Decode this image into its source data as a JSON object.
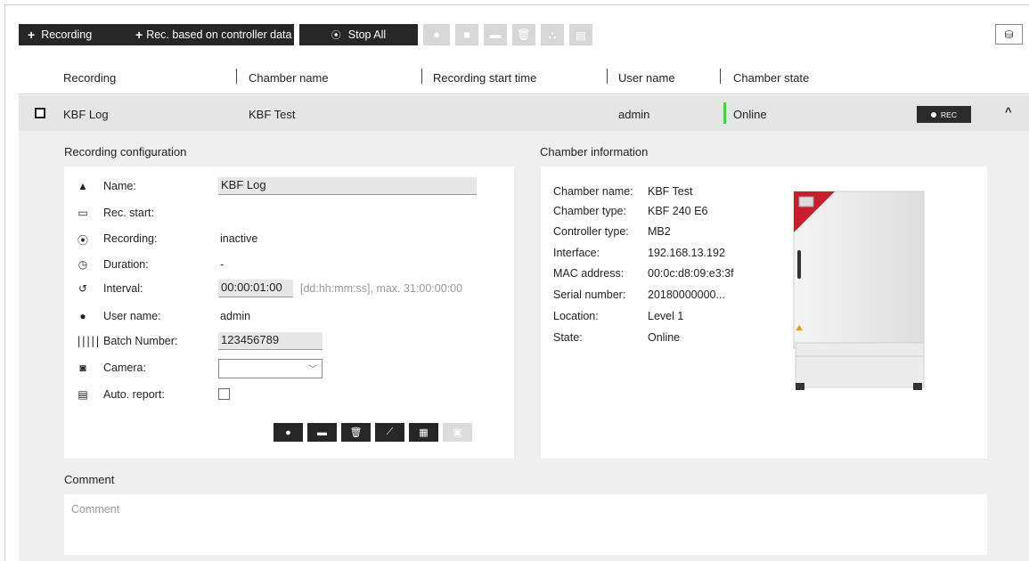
{
  "toolbar": {
    "recording_label": "Recording",
    "rec_controller_label": "Rec. based on controller data",
    "stop_all_label": "Stop All",
    "disabled_buttons": [
      "record-dot-icon",
      "stop-square-icon",
      "archive-icon",
      "trash-icon",
      "hierarchy-icon",
      "document-icon"
    ],
    "corner_icon": "export-stack-icon"
  },
  "table": {
    "headers": [
      "Recording",
      "Chamber name",
      "Recording start time",
      "User name",
      "Chamber state"
    ],
    "row": {
      "recording": "KBF Log",
      "chamber_name": "KBF Test",
      "start_time": "",
      "user_name": "admin",
      "state": "Online",
      "rec_label": "REC"
    }
  },
  "config": {
    "title": "Recording configuration",
    "name_label": "Name:",
    "name_value": "KBF Log",
    "rec_start_label": "Rec. start:",
    "rec_start_value": "",
    "recording_label": "Recording:",
    "recording_value": "inactive",
    "duration_label": "Duration:",
    "duration_value": "-",
    "interval_label": "Interval:",
    "interval_value": "00:00:01:00",
    "interval_hint": "[dd:hh:mm:ss], max. 31:00:00:00",
    "user_label": "User name:",
    "user_value": "admin",
    "batch_label": "Batch Number:",
    "batch_value": "123456789",
    "camera_label": "Camera:",
    "camera_value": "",
    "auto_report_label": "Auto. report:"
  },
  "chamber": {
    "title": "Chamber information",
    "rows": [
      {
        "label": "Chamber name:",
        "value": "KBF Test"
      },
      {
        "label": "Chamber type:",
        "value": "KBF 240 E6"
      },
      {
        "label": "Controller type:",
        "value": "MB2"
      },
      {
        "label": "Interface:",
        "value": "192.168.13.192"
      },
      {
        "label": "MAC address:",
        "value": "00:0c:d8:09:e3:3f"
      },
      {
        "label": "Serial number:",
        "value": "20180000000..."
      },
      {
        "label": "Location:",
        "value": "Level 1"
      },
      {
        "label": "State:",
        "value": "Online"
      }
    ]
  },
  "comment": {
    "title": "Comment",
    "placeholder": "Comment"
  },
  "colors": {
    "dark_button": "#262626",
    "online_green": "#3fd646",
    "row_highlight": "#e5e5e5",
    "panel_bg": "#efefef",
    "chamber_accent_red": "#c81e2c"
  }
}
